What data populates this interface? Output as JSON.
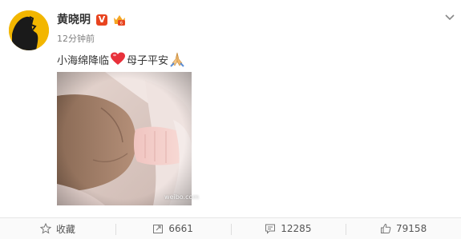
{
  "post": {
    "username": "黄晓明",
    "verified_badge": "V",
    "timestamp": "12分钟前",
    "text_part1": "小海绵降临",
    "text_part2": "母子平安",
    "watermark": "weibo.com"
  },
  "actions": {
    "favorite_label": "收藏",
    "repost_count": "6661",
    "comment_count": "12285",
    "like_count": "79158"
  },
  "icons": {
    "avatar": "avatar-silhouette",
    "verified": "verified-v-icon",
    "member": "crown-badge-icon",
    "menu": "chevron-down-icon",
    "heart": "heart-icon",
    "pray": "praying-hands-icon",
    "favorite": "star-icon",
    "repost": "repost-icon",
    "comment": "comment-icon",
    "like": "thumbs-up-icon"
  },
  "colors": {
    "verified": "#e8441f",
    "avatar_bg": "#f2b600",
    "heart": "#e8313b",
    "text": "#333333",
    "muted": "#808080"
  }
}
